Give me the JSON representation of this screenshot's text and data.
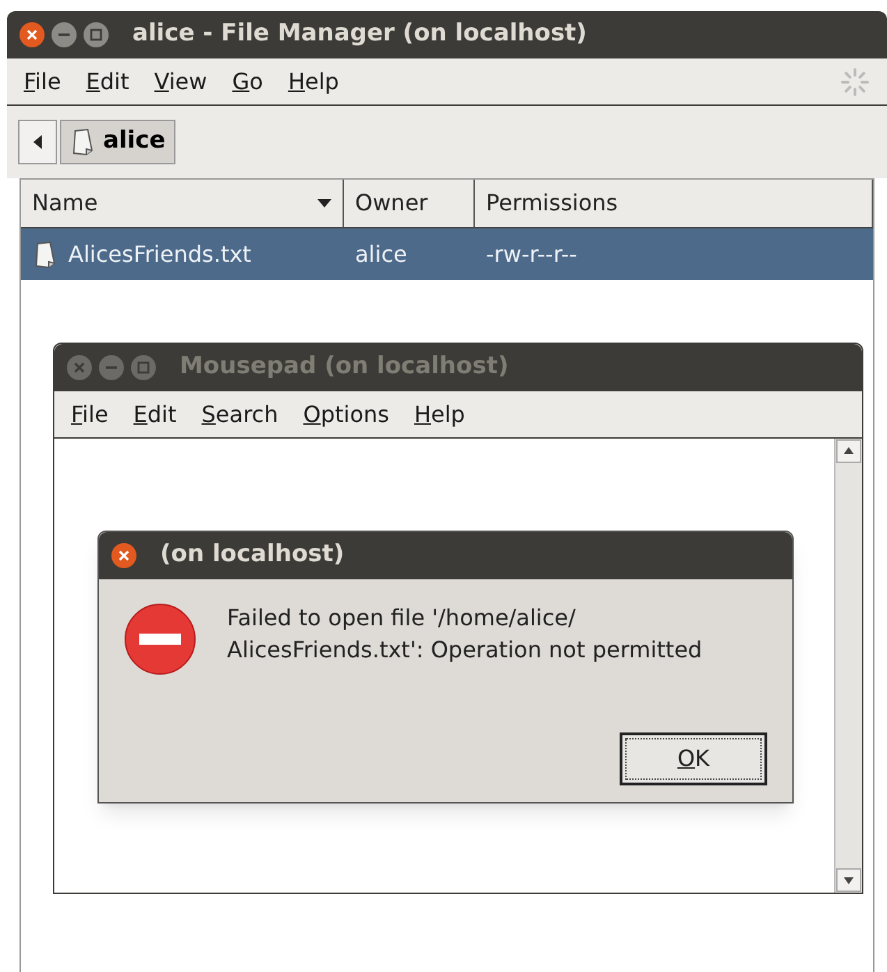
{
  "file_manager": {
    "title": "alice - File Manager (on localhost)",
    "active": true,
    "menu": [
      "File",
      "Edit",
      "View",
      "Go",
      "Help"
    ],
    "path": [
      {
        "label": "alice",
        "selected": true
      }
    ],
    "columns": [
      {
        "label": "Name",
        "sorted": true
      },
      {
        "label": "Owner",
        "sorted": false
      },
      {
        "label": "Permissions",
        "sorted": false
      }
    ],
    "rows": [
      {
        "name": "AlicesFriends.txt",
        "owner": "alice",
        "permissions": "-rw-r--r--",
        "selected": true
      }
    ]
  },
  "editor": {
    "title": "Mousepad (on localhost)",
    "active": false,
    "menu": [
      "File",
      "Edit",
      "Search",
      "Options",
      "Help"
    ]
  },
  "dialog": {
    "title": "(on localhost)",
    "active": true,
    "message": [
      "Failed to open file '/home/alice/",
      "AlicesFriends.txt': Operation not permitted"
    ],
    "buttons": [
      {
        "label": "OK",
        "selected": true
      }
    ]
  }
}
